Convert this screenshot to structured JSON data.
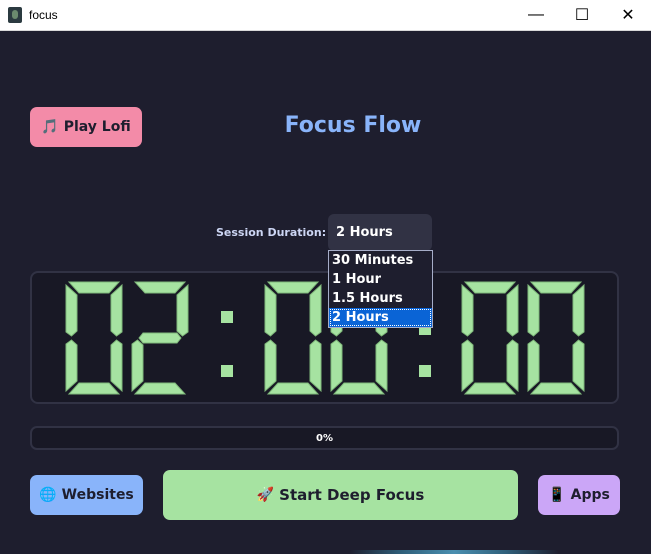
{
  "window": {
    "title": "focus",
    "minimize_glyph": "—",
    "maximize_glyph": "☐",
    "close_glyph": "✕"
  },
  "header": {
    "lofi_button": {
      "emoji": "🎵",
      "label": "Play Lofi"
    },
    "title": "Focus Flow"
  },
  "session": {
    "label": "Session Duration:",
    "selected": "2 Hours",
    "options": [
      "30 Minutes",
      "1 Hour",
      "1.5 Hours",
      "2 Hours"
    ]
  },
  "timer": {
    "display": "02:00:00",
    "digit_color": "#a6e3a1"
  },
  "progress": {
    "value": 0,
    "label": "0%"
  },
  "footer": {
    "websites_button": {
      "emoji": "🌐",
      "label": "Websites"
    },
    "start_button": {
      "emoji": "🚀",
      "label": "Start Deep Focus"
    },
    "apps_button": {
      "emoji": "📱",
      "label": "Apps"
    }
  },
  "colors": {
    "background": "#1e1e2e",
    "panel": "#181825",
    "border": "#313244",
    "pink": "#f38ba8",
    "blue": "#89b4fa",
    "green": "#a6e3a1",
    "purple": "#cba6f7",
    "select_highlight": "#0a64d6"
  }
}
